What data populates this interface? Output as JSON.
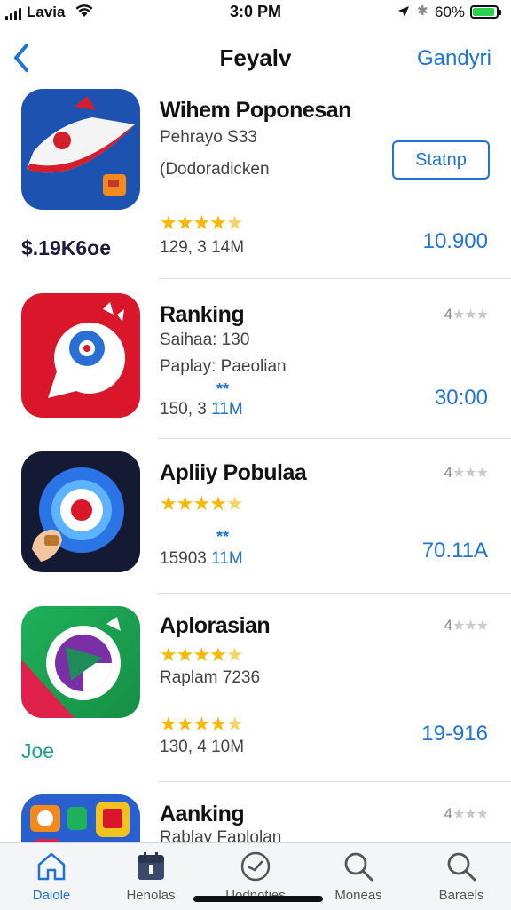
{
  "status": {
    "carrier": "Lavia",
    "time": "3:0 PM",
    "battery": "60%"
  },
  "nav": {
    "title": "Feyalv",
    "right": "Gandyri"
  },
  "apps": [
    {
      "title": "Wihem Poponesan",
      "line1": "Pehrayo S33",
      "line2": "(Dodoradicken",
      "button": "Statnp",
      "side_label": "$.19K6oe",
      "meta": "129, 3 14M",
      "amount": "10.900",
      "stars_rating": 4.5
    },
    {
      "title": "Ranking",
      "line1": "Saihaa: 130",
      "line2": "Paplay: Paeolian",
      "tag": "**",
      "meta_pre": "150, 3",
      "meta_hl": "11M",
      "amount": "30:00",
      "rating_prefix": "4"
    },
    {
      "title": "Apliiy Pobulaa",
      "tag": "**",
      "meta_pre": "15903",
      "meta_hl": "11M",
      "amount": "70.11A",
      "rating_prefix": "4",
      "stars_rating": 4.5
    },
    {
      "title": "Aplorasian",
      "line1": "Raplam 7236",
      "meta": "130, 4 10M",
      "amount": "19-916",
      "side_label": "Joe",
      "rating_prefix": "4",
      "stars_rating": 4.5
    },
    {
      "title": "Aanking",
      "line1": "Rablay Faplolan",
      "rating_prefix": "4"
    }
  ],
  "tabs": [
    {
      "label": "Daiole",
      "icon": "home-icon"
    },
    {
      "label": "Henolas",
      "icon": "calendar-icon"
    },
    {
      "label": "Uodnoties",
      "icon": "clock-icon"
    },
    {
      "label": "Moneas",
      "icon": "search-icon"
    },
    {
      "label": "Baraels",
      "icon": "search-icon"
    }
  ],
  "colors": {
    "accent": "#1d73d6",
    "star": "#f6b800"
  }
}
